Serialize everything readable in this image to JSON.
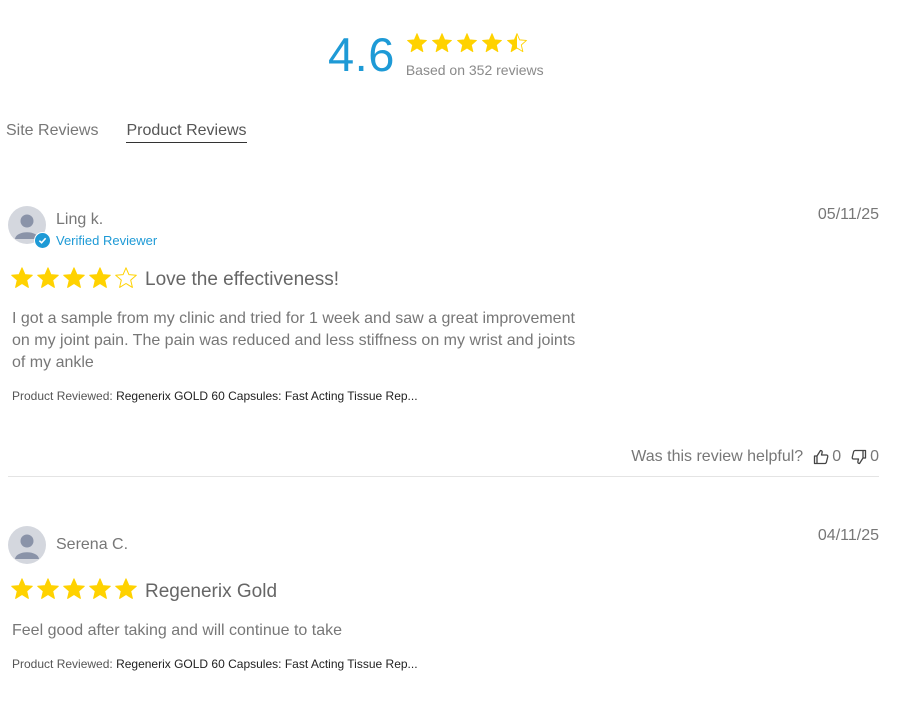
{
  "summary": {
    "average": "4.6",
    "rating": 4.6,
    "based_on": "Based on 352 reviews",
    "star_color": "#ffd200",
    "accent": "#1e9ad6"
  },
  "tabs": [
    {
      "label": "Site Reviews",
      "active": false
    },
    {
      "label": "Product Reviews",
      "active": true
    }
  ],
  "reviews": [
    {
      "author": "Ling k.",
      "verified_label": "Verified Reviewer",
      "date": "05/11/25",
      "rating": 4,
      "title": "Love the effectiveness!",
      "body": "I got a sample from my clinic and tried for 1 week and saw a great improvement on my joint pain. The pain was reduced and less stiffness on my wrist and joints of my ankle",
      "product_label": "Product Reviewed:",
      "product_name": "Regenerix GOLD 60 Capsules: Fast Acting Tissue Rep...",
      "helpful_label": "Was this review helpful?",
      "upvotes": "0",
      "downvotes": "0"
    },
    {
      "author": "Serena C.",
      "date": "04/11/25",
      "rating": 5,
      "title": "Regenerix Gold",
      "body": "Feel good after taking and will continue to take",
      "product_label": "Product Reviewed:",
      "product_name": "Regenerix GOLD 60 Capsules: Fast Acting Tissue Rep..."
    }
  ],
  "icons": {
    "star": "star-icon",
    "avatar": "user-avatar-icon",
    "verified": "verified-check-icon",
    "thumbs_up": "thumbs-up-icon",
    "thumbs_down": "thumbs-down-icon"
  }
}
